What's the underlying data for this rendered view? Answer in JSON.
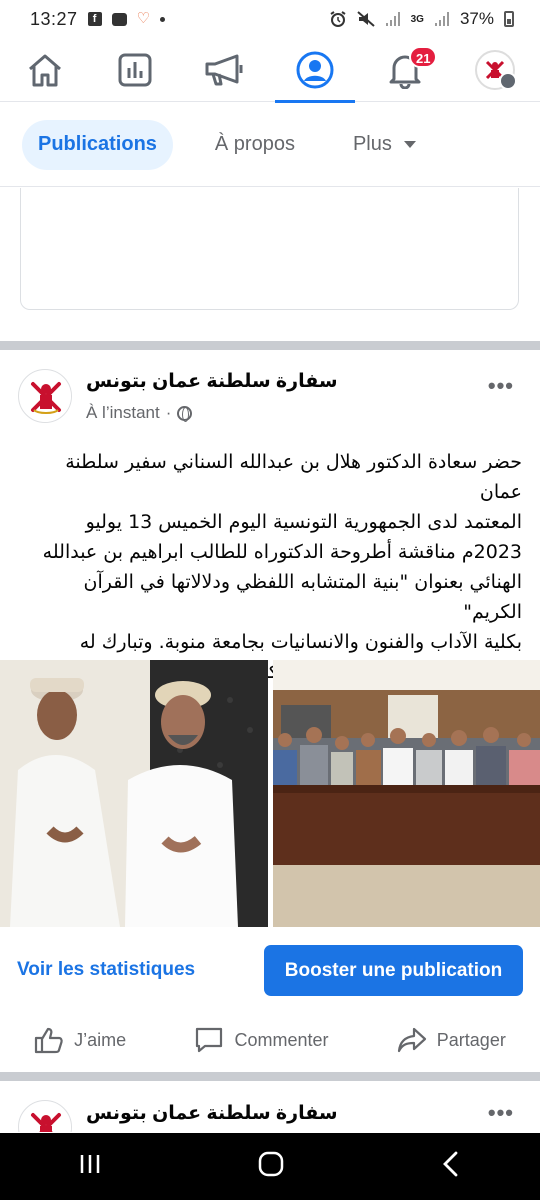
{
  "status_bar": {
    "time": "13:27",
    "network": "3G",
    "battery": "37%"
  },
  "nav": {
    "notifications_badge": "21"
  },
  "page_tabs": {
    "items": [
      {
        "label": "Publications",
        "active": true
      },
      {
        "label": "À propos",
        "active": false
      },
      {
        "label": "Plus",
        "active": false
      }
    ]
  },
  "post": {
    "page_name": "سفارة سلطنة عمان بتونس",
    "timestamp": "À l’instant",
    "separator_dot": "·",
    "text_lines": [
      "حضر سعادة الدكتور هلال بن عبدالله السناني سفير سلطنة عمان",
      "المعتمد لدى الجمهورية التونسية اليوم الخميس 13 يوليو",
      "2023م مناقشة أطروحة الدكتوراه للطالب ابراهيم بن عبدالله",
      "الهنائي  بعنوان \"بنية المتشابه اللفظي ودلالاتها في القرآن الكريم\"",
      "بكلية الآداب والفنون والانسانيات بجامعة منوبة. وتبارك له",
      "السفارة حصوله على شهادة الدكتوراه بدرجة مشرف جدا."
    ],
    "stats_link": "Voir les statistiques",
    "boost_button": "Booster une publication",
    "actions": {
      "like": "J’aime",
      "comment": "Commenter",
      "share": "Partager"
    }
  },
  "next_post": {
    "page_name": "سفارة سلطنة عمان بتونس"
  },
  "colors": {
    "accent": "#1b74e4",
    "badge": "#e41e3f",
    "muted": "#65676b"
  }
}
